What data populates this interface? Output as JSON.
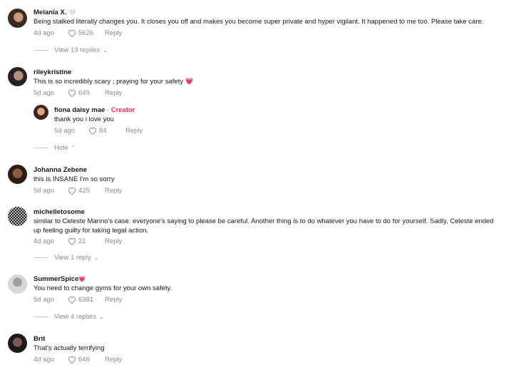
{
  "comments": [
    {
      "username": "Melanïa X.",
      "badge": "🤍",
      "text": "Being stalked literally changes you. It closes you off and makes you become super private and hyper vigilant. It happened to me too. Please take care.",
      "date": "4d ago",
      "likes": "5626",
      "reply": "Reply",
      "thread": "View 19 replies",
      "avatar_colors": [
        "#3b2a22",
        "#c79a7e"
      ]
    },
    {
      "username": "rileykristine",
      "text": "This is so incredibly scary ; praying for your safety 💗",
      "date": "5d ago",
      "likes": "649",
      "reply": "Reply",
      "avatar_colors": [
        "#2a2222",
        "#b58d7a"
      ],
      "replies": [
        {
          "username": "fiona daisy mae",
          "separator": " · ",
          "creator_label": "Creator",
          "text": "thank you i love you",
          "date": "5d ago",
          "likes": "84",
          "reply": "Reply",
          "avatar_colors": [
            "#3d2418",
            "#d4a58b"
          ]
        }
      ],
      "thread": "Hide"
    },
    {
      "username": "Johanna Zebene",
      "text": "this is INSANE I'm so sorry",
      "date": "5d ago",
      "likes": "425",
      "reply": "Reply",
      "avatar_colors": [
        "#2b1b14",
        "#8b5a44"
      ]
    },
    {
      "username": "michelletosome",
      "text": "similar to Celeste Manno's case. everyone's saying to please be careful. Another thing is to do whatever you have to do for yourself. Sadly, Celeste ended up feeling guilty for taking legal action.",
      "date": "4d ago",
      "likes": "21",
      "reply": "Reply",
      "thread": "View 1 reply",
      "avatar_colors": [
        "#222222",
        "#9a9a9a"
      ]
    },
    {
      "username": "SummerSpice",
      "badge": "💗",
      "text": "You need to change gyms for your own safety.",
      "date": "5d ago",
      "likes": "6381",
      "reply": "Reply",
      "thread": "View 4 replies",
      "avatar_colors": [
        "#cfcfcf",
        "#9e9e9e"
      ]
    },
    {
      "username": "Brit",
      "text": "That's actually terrifying",
      "date": "4d ago",
      "likes": "646",
      "reply": "Reply",
      "avatar_colors": [
        "#1f1a1a",
        "#7a5a4c"
      ]
    }
  ]
}
